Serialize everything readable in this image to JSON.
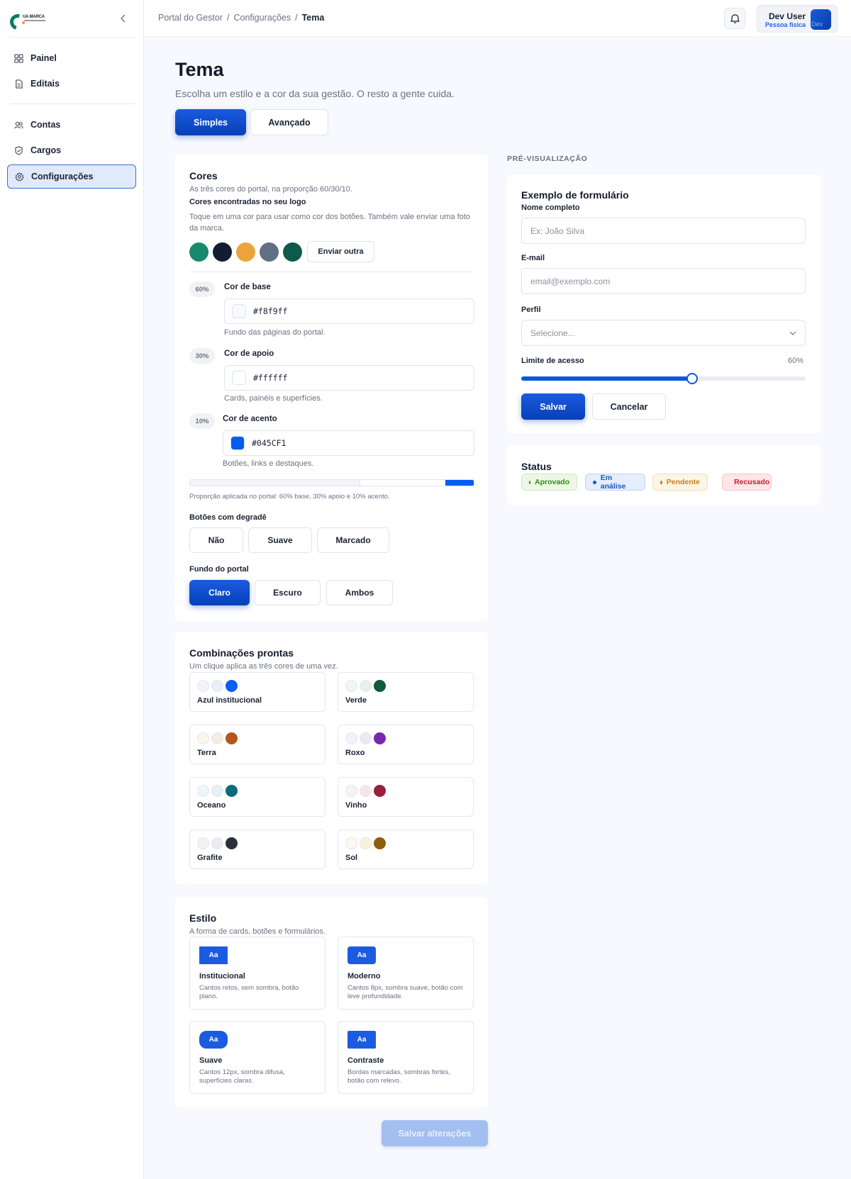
{
  "logo": {
    "text": "UA MARCA"
  },
  "sidebar": {
    "items": [
      {
        "label": "Painel",
        "icon": "grid-icon"
      },
      {
        "label": "Editais",
        "icon": "document-icon"
      },
      {
        "label": "Contas",
        "icon": "users-icon"
      },
      {
        "label": "Cargos",
        "icon": "shield-icon"
      },
      {
        "label": "Configurações",
        "icon": "gear-icon",
        "active": true
      }
    ]
  },
  "breadcrumb": [
    "Portal do Gestor",
    "Configurações",
    "Tema"
  ],
  "user": {
    "name": "Dev User",
    "role": "Pessoa física",
    "avatar_text": "Dev"
  },
  "page": {
    "title": "Tema",
    "subtitle": "Escolha um estilo e a cor da sua gestão. O resto a gente cuida."
  },
  "tabs": [
    "Simples",
    "Avançado"
  ],
  "cores": {
    "title": "Cores",
    "desc": "As três cores do portal, na proporção 60/30/10.",
    "logo_title": "Cores encontradas no seu logo",
    "logo_desc": "Toque em uma cor para usar como cor dos botões. Também vale enviar uma foto da marca.",
    "logo_colors": [
      "#158a6e",
      "#131d31",
      "#eba43c",
      "#627085",
      "#0f5a4d"
    ],
    "upload_label": "Enviar outra",
    "base": {
      "pct": "60%",
      "label": "Cor de base",
      "hex": "#f8f9ff",
      "hint": "Fundo das páginas do portal."
    },
    "apoio": {
      "pct": "30%",
      "label": "Cor de apoio",
      "hex": "#ffffff",
      "hint": "Cards, painéis e superfícies."
    },
    "acento": {
      "pct": "10%",
      "label": "Cor de acento",
      "hex": "#045CF1",
      "hint": "Botões, links e destaques."
    },
    "ratio_note": "Proporção aplicada no portal: 60% base, 30% apoio e 10% acento.",
    "gradient_title": "Botões com degradê",
    "gradient_opts": [
      "Não",
      "Suave",
      "Marcado"
    ],
    "fundo_title": "Fundo do portal",
    "fundo_opts": [
      "Claro",
      "Escuro",
      "Ambos"
    ]
  },
  "combos": {
    "title": "Combinações prontas",
    "desc": "Um clique aplica as três cores de uma vez.",
    "items": [
      {
        "name": "Azul institucional",
        "colors": [
          "#f1f4fc",
          "#eaeef8",
          "#0c5ef0"
        ]
      },
      {
        "name": "Verde",
        "colors": [
          "#f1f6f3",
          "#e5f1ea",
          "#0d5a3c"
        ]
      },
      {
        "name": "Terra",
        "colors": [
          "#fbf5ee",
          "#f8ebe0",
          "#b4561e"
        ]
      },
      {
        "name": "Roxo",
        "colors": [
          "#f3f2fa",
          "#ede8f7",
          "#7a28b0"
        ]
      },
      {
        "name": "Oceano",
        "colors": [
          "#eef6f8",
          "#e5f1f4",
          "#0c6b7c"
        ]
      },
      {
        "name": "Vinho",
        "colors": [
          "#f8f2f3",
          "#f6e6e8",
          "#9a1f3a"
        ]
      },
      {
        "name": "Grafite",
        "colors": [
          "#f1f2f4",
          "#eaecef",
          "#2b2f38"
        ]
      },
      {
        "name": "Sol",
        "colors": [
          "#fbf8ed",
          "#f8f1dc",
          "#8c5f08"
        ]
      }
    ]
  },
  "estilo": {
    "title": "Estilo",
    "desc": "A forma de cards, botões e formulários.",
    "items": [
      {
        "aa": "Aa",
        "name": "Institucional",
        "desc": "Cantos retos, sem sombra, botão plano."
      },
      {
        "aa": "Aa",
        "name": "Moderno",
        "desc": "Cantos 8px, sombra suave, botão com leve profundidade."
      },
      {
        "aa": "Aa",
        "name": "Suave",
        "desc": "Cantos 12px, sombra difusa, superfícies claras."
      },
      {
        "aa": "Aa",
        "name": "Contraste",
        "desc": "Bordas marcadas, sombras fortes, botão com relevo."
      }
    ]
  },
  "save_label": "Salvar alterações",
  "preview": {
    "label": "PRÉ-VISUALIZAÇÃO",
    "form_title": "Exemplo de formulário",
    "name_label": "Nome completo",
    "name_placeholder": "Ex: João Silva",
    "email_label": "E-mail",
    "email_placeholder": "email@exemplo.com",
    "perfil_label": "Perfil",
    "perfil_value": "Selecione...",
    "limit_label": "Limite de acesso",
    "limit_value": "60%",
    "limit_fraction": 0.6,
    "save": "Salvar",
    "cancel": "Cancelar",
    "status_title": "Status",
    "statuses": [
      {
        "label": "Aprovado",
        "fg": "#2f8a1c",
        "bg": "#ecf8e5",
        "border": "#cde9bd"
      },
      {
        "label": "Em análise",
        "fg": "#1d57c4",
        "bg": "#e4eefc",
        "border": "#c2d5f5"
      },
      {
        "label": "Pendente",
        "fg": "#c9821b",
        "bg": "#fdf5e4",
        "border": "#f4e2b9"
      },
      {
        "label": "Recusado",
        "fg": "#c42030",
        "bg": "#fde6e8",
        "border": "#f6c4ca"
      }
    ]
  },
  "colors": {
    "accent": "#045CF1",
    "primary_dark": "#0640b8"
  }
}
